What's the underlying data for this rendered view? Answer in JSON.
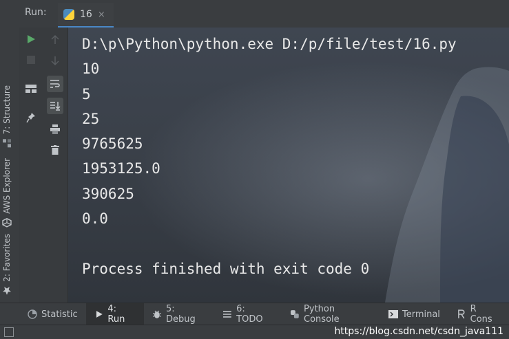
{
  "header": {
    "run_label": "Run:",
    "tab_name": "16",
    "tab_close": "×"
  },
  "left_tools": {
    "structure": "7: Structure",
    "aws": "AWS Explorer",
    "favorites": "2: Favorites"
  },
  "console": {
    "lines": [
      "D:\\p\\Python\\python.exe D:/p/file/test/16.py",
      "10",
      "5",
      "25",
      "9765625",
      "1953125.0",
      "390625",
      "0.0",
      "",
      "Process finished with exit code 0"
    ]
  },
  "bottom_tools": {
    "statistic": "Statistic",
    "run": "4: Run",
    "debug": "5: Debug",
    "todo": "6: TODO",
    "python_console": "Python Console",
    "terminal": "Terminal",
    "r_console": "R Cons"
  },
  "status": {
    "watermark": "https://blog.csdn.net/csdn_java111"
  },
  "colors": {
    "run_green": "#59a869",
    "accent_blue": "#4a88c7"
  }
}
